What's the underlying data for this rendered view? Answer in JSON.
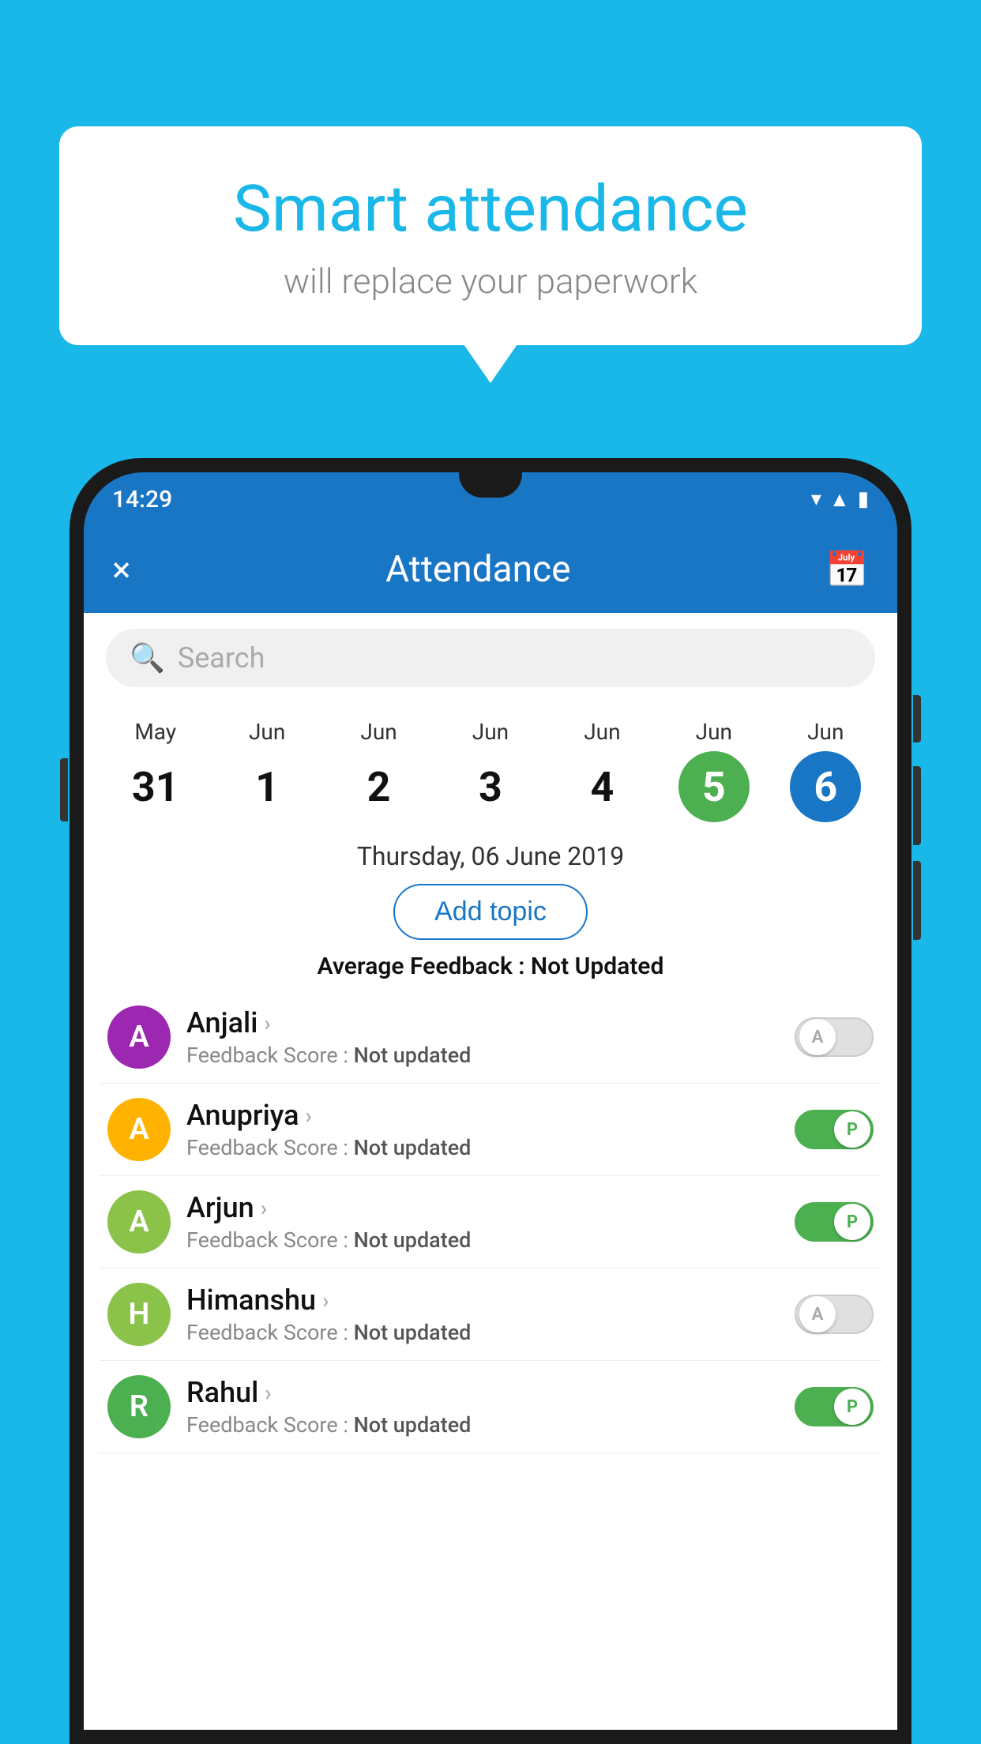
{
  "background_color": "#1ab8e8",
  "bubble": {
    "title": "Smart attendance",
    "subtitle": "will replace your paperwork"
  },
  "status_bar": {
    "time": "14:29",
    "icons": [
      "wifi",
      "signal",
      "battery"
    ]
  },
  "app_bar": {
    "title": "Attendance",
    "close_label": "×",
    "calendar_label": "📅"
  },
  "search": {
    "placeholder": "Search"
  },
  "calendar": {
    "days": [
      {
        "month": "May",
        "num": "31",
        "style": "normal"
      },
      {
        "month": "Jun",
        "num": "1",
        "style": "normal"
      },
      {
        "month": "Jun",
        "num": "2",
        "style": "normal"
      },
      {
        "month": "Jun",
        "num": "3",
        "style": "normal"
      },
      {
        "month": "Jun",
        "num": "4",
        "style": "normal"
      },
      {
        "month": "Jun",
        "num": "5",
        "style": "green"
      },
      {
        "month": "Jun",
        "num": "6",
        "style": "blue"
      }
    ]
  },
  "selected_date": "Thursday, 06 June 2019",
  "add_topic_label": "Add topic",
  "avg_feedback_label": "Average Feedback :",
  "avg_feedback_value": "Not Updated",
  "students": [
    {
      "name": "Anjali",
      "avatar_letter": "A",
      "avatar_color": "#9c27b0",
      "feedback": "Not updated",
      "toggle": "off",
      "toggle_label": "A"
    },
    {
      "name": "Anupriya",
      "avatar_letter": "A",
      "avatar_color": "#ffb300",
      "feedback": "Not updated",
      "toggle": "on",
      "toggle_label": "P"
    },
    {
      "name": "Arjun",
      "avatar_letter": "A",
      "avatar_color": "#8bc34a",
      "feedback": "Not updated",
      "toggle": "on",
      "toggle_label": "P"
    },
    {
      "name": "Himanshu",
      "avatar_letter": "H",
      "avatar_color": "#8bc34a",
      "feedback": "Not updated",
      "toggle": "off",
      "toggle_label": "A"
    },
    {
      "name": "Rahul",
      "avatar_letter": "R",
      "avatar_color": "#4caf50",
      "feedback": "Not updated",
      "toggle": "on",
      "toggle_label": "P"
    }
  ],
  "feedback_label": "Feedback Score :"
}
